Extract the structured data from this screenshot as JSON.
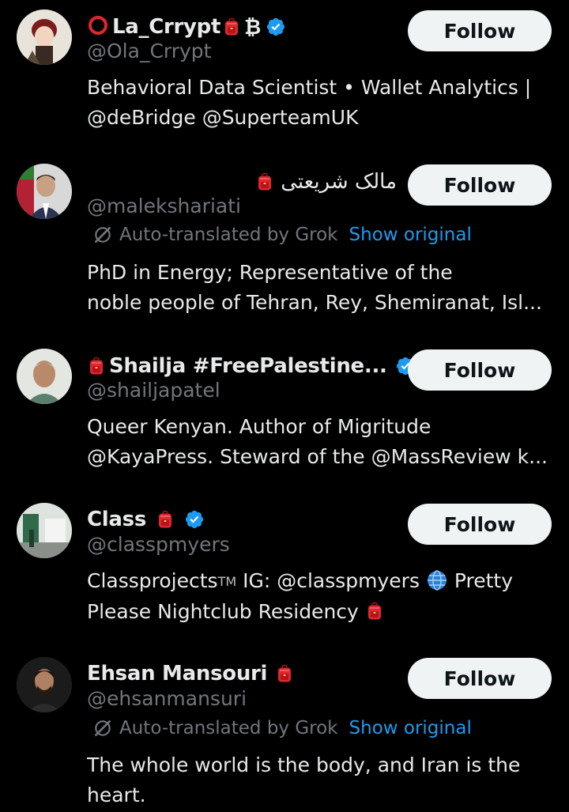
{
  "follow_label": "Follow",
  "translate": {
    "text": "Auto-translated by Grok",
    "show_original": "Show original"
  },
  "users": [
    {
      "name": "La_Crrypt",
      "name_suffix": "₿",
      "handle": "@Ola_Crrypt",
      "verified": true,
      "bio": [
        "Behavioral Data Scientist • Wallet Analytics |",
        "@deBridge @SuperteamUK"
      ]
    },
    {
      "name": "مالک شریعتی",
      "handle": "@malekshariati",
      "verified": false,
      "bio": [
        "PhD in Energy; Representative of the",
        "noble people of Tehran, Rey, Shemiranat, Isl..."
      ]
    },
    {
      "name": "Shailja #FreePalestine...",
      "handle": "@shailjapatel",
      "verified": true,
      "bio": [
        "Queer Kenyan. Author of Migritude",
        "@KayaPress. Steward of the @MassReview k..."
      ]
    },
    {
      "name": "Class",
      "handle": "@classpmyers",
      "verified": true,
      "bio_a": "Classprojects",
      "bio_tm": "TM",
      "bio_b": " IG: @classpmyers ",
      "bio_c": " Pretty",
      "bio_line2": "Please Nightclub Residency "
    },
    {
      "name": "Ehsan Mansouri",
      "handle": "@ehsanmansuri",
      "verified": false,
      "bio": [
        "The whole world is the body, and Iran is the",
        "heart."
      ]
    }
  ],
  "colors": {
    "background": "#000000",
    "text": "#e7e9ea",
    "secondary": "#71767b",
    "link": "#1d9bf0",
    "verified": "#1d9bf0",
    "follow_bg": "#eff3f4",
    "follow_text": "#0f1419"
  }
}
